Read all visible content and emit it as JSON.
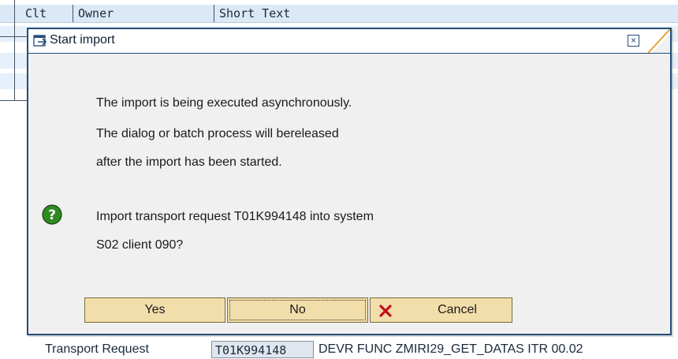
{
  "background": {
    "columns": {
      "clt": "Clt",
      "owner": "Owner",
      "short_text": "Short Text"
    },
    "bottom_row": {
      "label": "Transport Request",
      "request_value": "T01K994148",
      "rest_text": "DEVR FUNC ZMIRI29_GET_DATAS ITR 00.02"
    }
  },
  "dialog": {
    "title": "Start import",
    "close_glyph": "×",
    "message_lines": [
      "The import is being executed asynchronously.",
      "The dialog or batch process will bereleased",
      "after the import has been started."
    ],
    "question_lines": [
      "Import transport request T01K994148 into system",
      "S02 client 090?"
    ],
    "buttons": {
      "yes": "Yes",
      "no": "No",
      "cancel": "Cancel"
    }
  },
  "colors": {
    "dialog_border": "#244c79",
    "button_fill": "#f2deaa",
    "question_icon": "#2f8a1f",
    "cancel_x": "#c0101b"
  },
  "icons": {
    "title_icon": "window-start-icon",
    "question_icon": "question-icon",
    "cancel_icon": "red-x-icon"
  }
}
